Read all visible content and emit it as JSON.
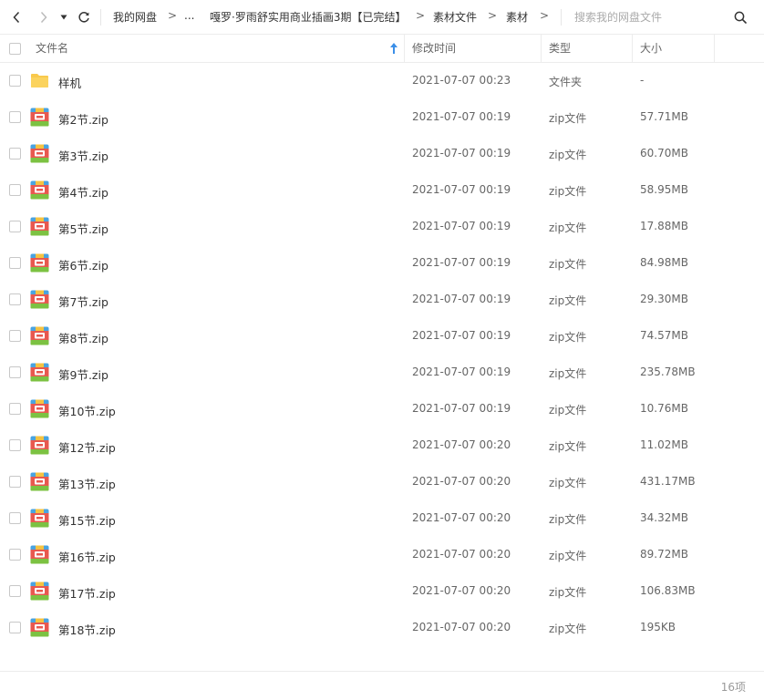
{
  "toolbar": {
    "back_icon": "chevron-left-icon",
    "forward_icon": "chevron-right-icon",
    "history_icon": "caret-down-icon",
    "refresh_icon": "refresh-icon",
    "search_icon": "search-icon"
  },
  "breadcrumb": {
    "root": "我的网盘",
    "ellipsis": "...",
    "level1": "嘎罗·罗雨舒实用商业插画3期【已完结】",
    "level2": "素材文件",
    "current": "素材",
    "separator": ">"
  },
  "search": {
    "placeholder": "搜索我的网盘文件",
    "value": ""
  },
  "columns": {
    "name": "文件名",
    "modified": "修改时间",
    "type": "类型",
    "size": "大小",
    "sort_indicator": "ascending"
  },
  "colors": {
    "folder": "#f9c94c",
    "sort_arrow": "#3b8fe8",
    "zip_red": "#e8584f",
    "zip_blue": "#4aa3e0",
    "zip_green": "#7cc242",
    "zip_yellow": "#f5c342"
  },
  "files": [
    {
      "name": "样机",
      "modified": "2021-07-07 00:23",
      "type": "文件夹",
      "size": "-",
      "icon": "folder-icon"
    },
    {
      "name": "第2节.zip",
      "modified": "2021-07-07 00:19",
      "type": "zip文件",
      "size": "57.71MB",
      "icon": "zip-archive-icon"
    },
    {
      "name": "第3节.zip",
      "modified": "2021-07-07 00:19",
      "type": "zip文件",
      "size": "60.70MB",
      "icon": "zip-archive-icon"
    },
    {
      "name": "第4节.zip",
      "modified": "2021-07-07 00:19",
      "type": "zip文件",
      "size": "58.95MB",
      "icon": "zip-archive-icon"
    },
    {
      "name": "第5节.zip",
      "modified": "2021-07-07 00:19",
      "type": "zip文件",
      "size": "17.88MB",
      "icon": "zip-archive-icon"
    },
    {
      "name": "第6节.zip",
      "modified": "2021-07-07 00:19",
      "type": "zip文件",
      "size": "84.98MB",
      "icon": "zip-archive-icon"
    },
    {
      "name": "第7节.zip",
      "modified": "2021-07-07 00:19",
      "type": "zip文件",
      "size": "29.30MB",
      "icon": "zip-archive-icon"
    },
    {
      "name": "第8节.zip",
      "modified": "2021-07-07 00:19",
      "type": "zip文件",
      "size": "74.57MB",
      "icon": "zip-archive-icon"
    },
    {
      "name": "第9节.zip",
      "modified": "2021-07-07 00:19",
      "type": "zip文件",
      "size": "235.78MB",
      "icon": "zip-archive-icon"
    },
    {
      "name": "第10节.zip",
      "modified": "2021-07-07 00:19",
      "type": "zip文件",
      "size": "10.76MB",
      "icon": "zip-archive-icon"
    },
    {
      "name": "第12节.zip",
      "modified": "2021-07-07 00:20",
      "type": "zip文件",
      "size": "11.02MB",
      "icon": "zip-archive-icon"
    },
    {
      "name": "第13节.zip",
      "modified": "2021-07-07 00:20",
      "type": "zip文件",
      "size": "431.17MB",
      "icon": "zip-archive-icon"
    },
    {
      "name": "第15节.zip",
      "modified": "2021-07-07 00:20",
      "type": "zip文件",
      "size": "34.32MB",
      "icon": "zip-archive-icon"
    },
    {
      "name": "第16节.zip",
      "modified": "2021-07-07 00:20",
      "type": "zip文件",
      "size": "89.72MB",
      "icon": "zip-archive-icon"
    },
    {
      "name": "第17节.zip",
      "modified": "2021-07-07 00:20",
      "type": "zip文件",
      "size": "106.83MB",
      "icon": "zip-archive-icon"
    },
    {
      "name": "第18节.zip",
      "modified": "2021-07-07 00:20",
      "type": "zip文件",
      "size": "195KB",
      "icon": "zip-archive-icon"
    }
  ],
  "footer": {
    "count": "16项"
  }
}
